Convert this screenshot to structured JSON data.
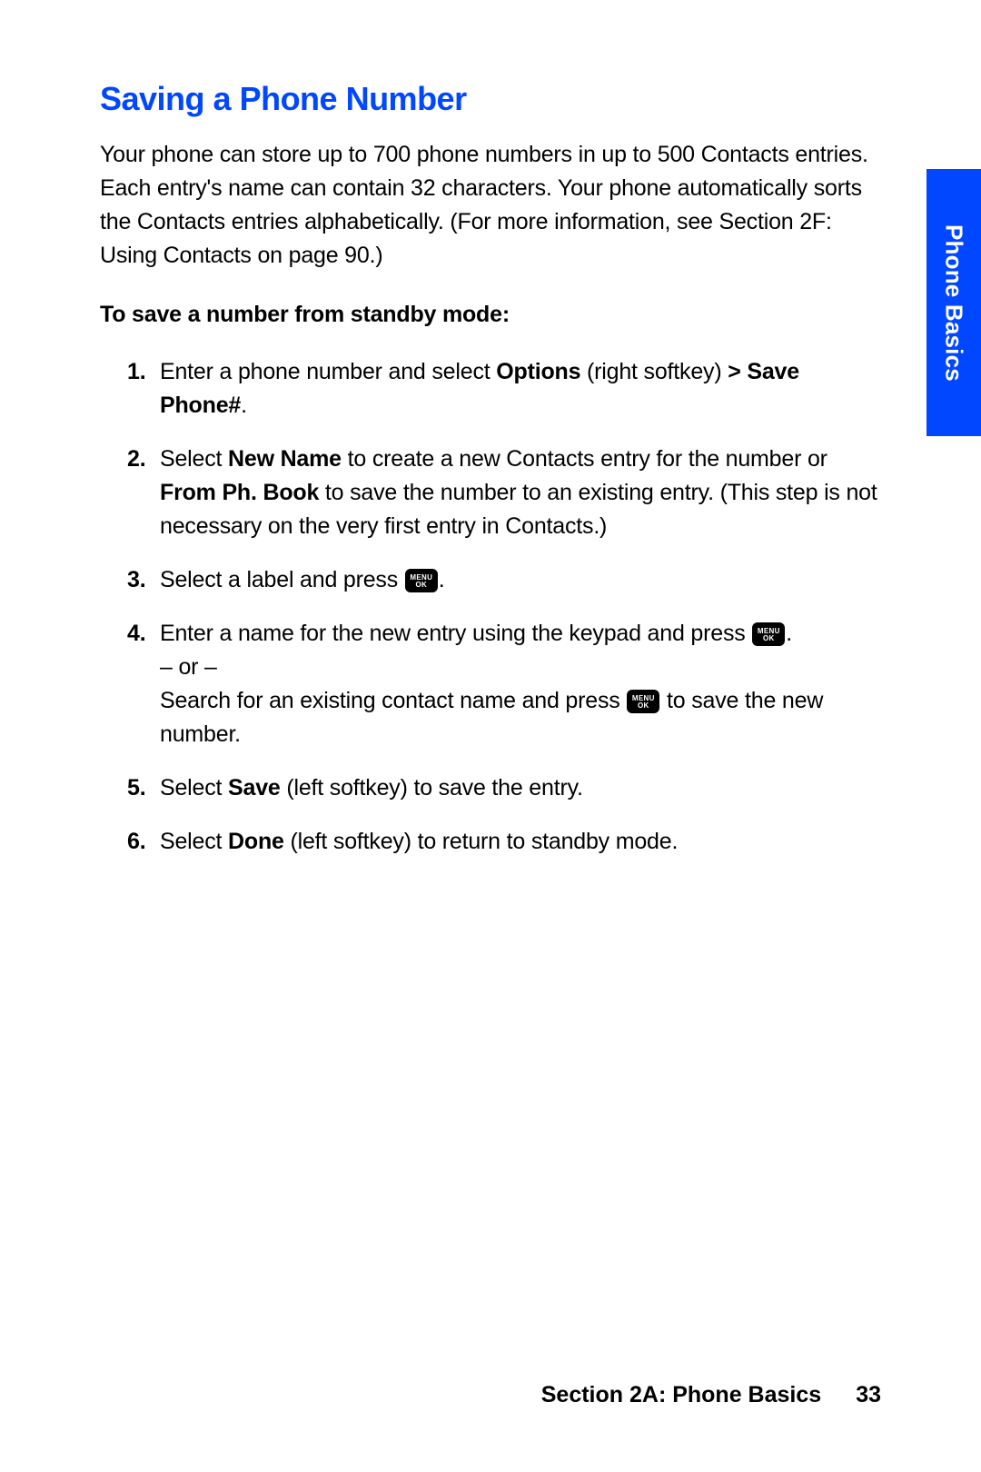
{
  "colors": {
    "accent": "#0047ff"
  },
  "heading": "Saving a Phone Number",
  "intro": "Your phone can store up to 700 phone numbers in up to 500 Contacts entries. Each entry's name can contain 32 characters. Your phone automatically sorts the Contacts entries alphabetically. (For more information, see Section 2F: Using Contacts on page 90.)",
  "subhead": "To save a number from standby mode:",
  "steps": {
    "s1": {
      "pre": "Enter a phone number and select ",
      "bold1": "Options",
      "mid": " (right softkey)",
      "bold2": " > Save Phone#",
      "post": "."
    },
    "s2": {
      "pre": "Select ",
      "bold1": "New Name",
      "mid": " to create a new Contacts entry for the number or ",
      "bold2": "From Ph. Book",
      "post": " to save the number to an existing entry. (This step is not necessary on the very first entry in Contacts.)"
    },
    "s3": {
      "pre": "Select a label and press ",
      "post": "."
    },
    "s4": {
      "line1pre": "Enter a name for the new entry using the keypad and press ",
      "line1post": ".",
      "or": "– or –",
      "line2pre": "Search for an existing contact name and press ",
      "line2post": " to save the new number."
    },
    "s5": {
      "pre": "Select ",
      "bold": "Save",
      "post": " (left softkey) to save the entry."
    },
    "s6": {
      "pre": "Select ",
      "bold": "Done",
      "post": " (left softkey) to return to standby mode."
    }
  },
  "key": {
    "line1": "MENU",
    "line2": "OK"
  },
  "sideTab": "Phone Basics",
  "footer": {
    "section": "Section 2A: Phone Basics",
    "page": "33"
  }
}
